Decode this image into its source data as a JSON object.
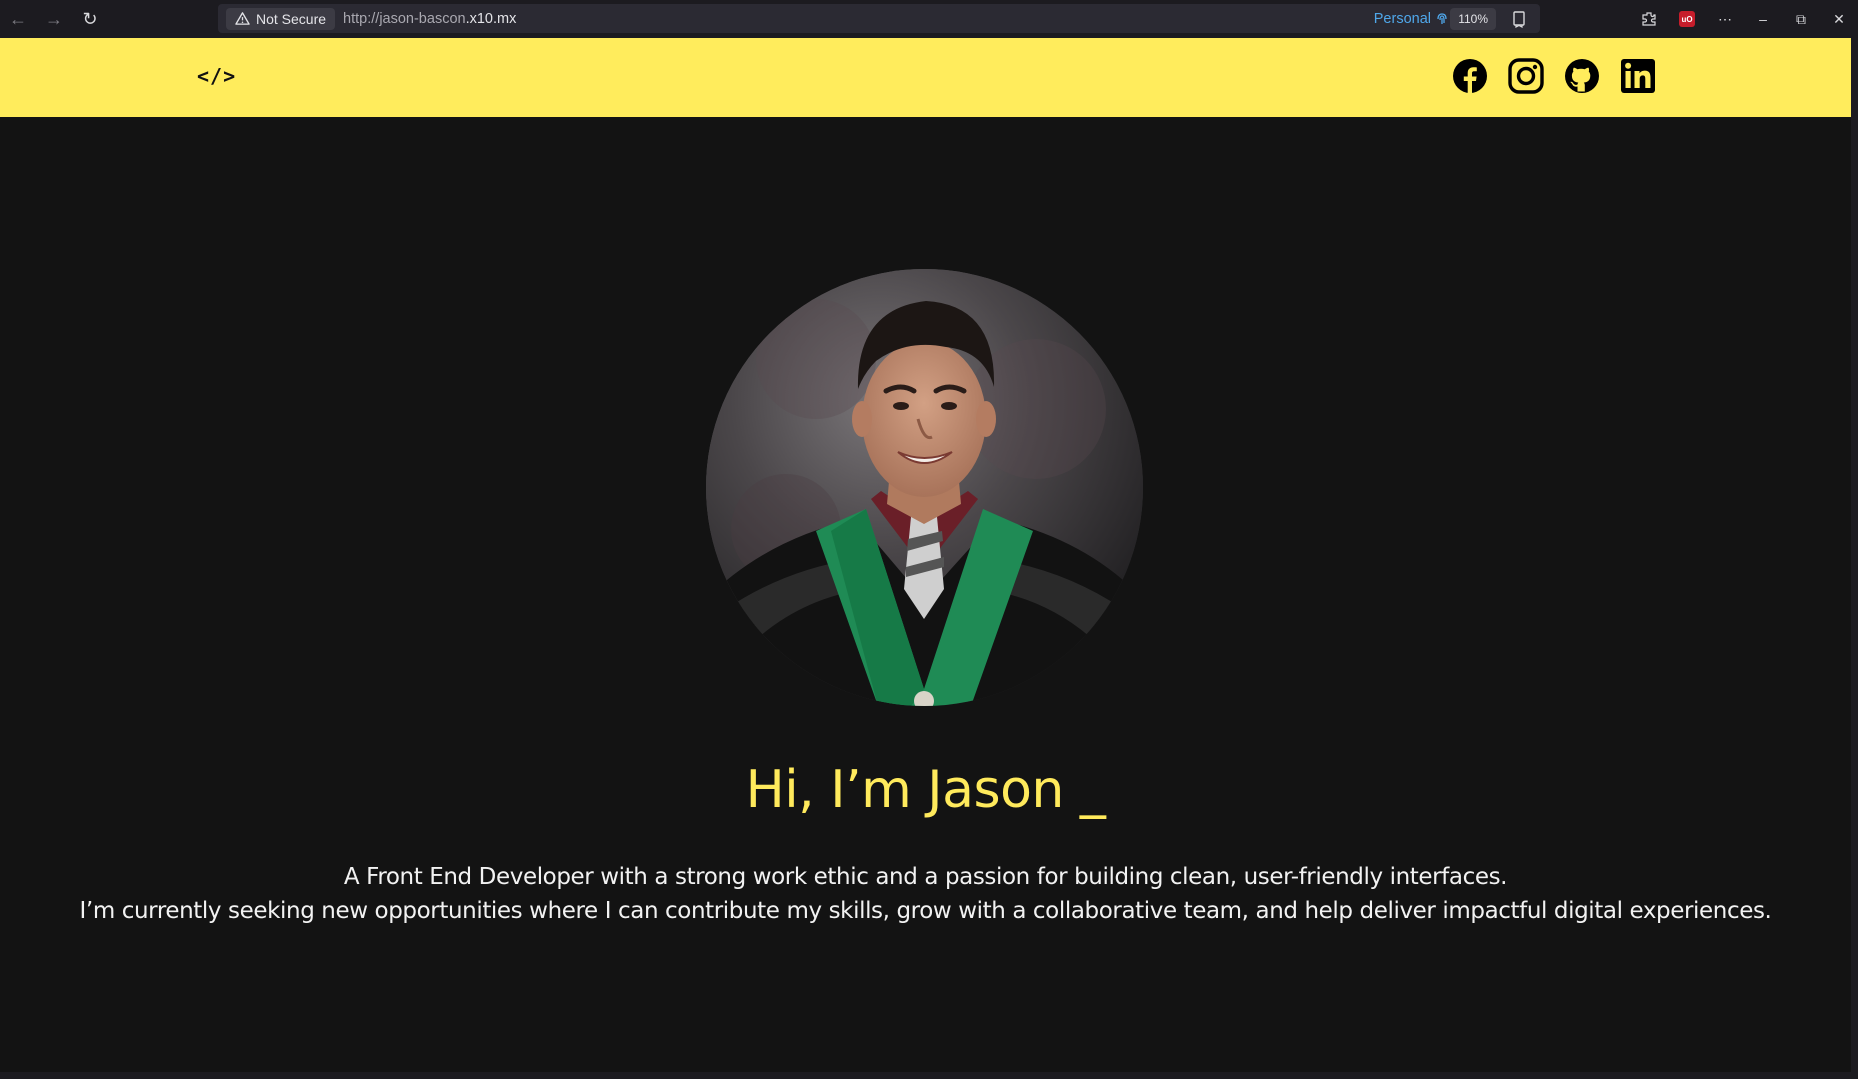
{
  "browser": {
    "security_label": "Not Secure",
    "url_prefix": "http://jason-bascon",
    "url_domain": ".x10.mx",
    "profile": "Personal",
    "zoom": "110%"
  },
  "site": {
    "logo": "</>",
    "socials": [
      {
        "name": "Facebook",
        "icon": "facebook-icon"
      },
      {
        "name": "Instagram",
        "icon": "instagram-icon"
      },
      {
        "name": "GitHub",
        "icon": "github-icon"
      },
      {
        "name": "LinkedIn",
        "icon": "linkedin-icon"
      }
    ],
    "headline": "Hi, I’m Jason _",
    "bio_line1": "A Front End Developer with a strong work ethic and a passion for building clean, user-friendly interfaces.",
    "bio_line2": "I’m currently seeking new opportunities where I can contribute my skills, grow with a collaborative team, and help deliver impactful digital experiences.",
    "colors": {
      "accent": "#ffec5c",
      "background": "#131313",
      "headline": "#ffea5c"
    }
  }
}
